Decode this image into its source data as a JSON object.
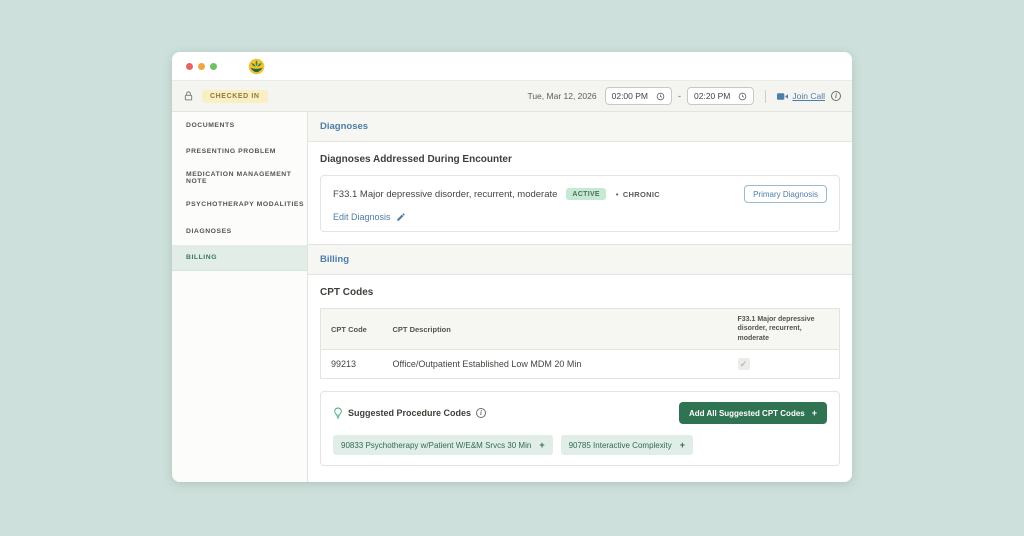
{
  "header": {
    "checked_in": "CHECKED IN",
    "date": "Tue, Mar 12, 2026",
    "start_time": "02:00 PM",
    "end_time": "02:20 PM",
    "time_separator": "-",
    "join_call": "Join Call"
  },
  "sidebar": {
    "active_item": "BILLING",
    "items": [
      {
        "label": "DOCUMENTS"
      },
      {
        "label": "PRESENTING PROBLEM"
      },
      {
        "label": "MEDICATION MANAGEMENT NOTE"
      },
      {
        "label": "PSYCHOTHERAPY MODALITIES"
      },
      {
        "label": "DIAGNOSES"
      },
      {
        "label": "BILLING"
      }
    ]
  },
  "diagnoses": {
    "section_title": "Diagnoses",
    "heading": "Diagnoses Addressed During Encounter",
    "name": "F33.1 Major depressive disorder, recurrent, moderate",
    "status_badge": "ACTIVE",
    "chronicity": "CHRONIC",
    "primary_button": "Primary Diagnosis",
    "edit_link": "Edit Diagnosis"
  },
  "billing": {
    "section_title": "Billing",
    "heading": "CPT Codes",
    "table": {
      "col_code": "CPT Code",
      "col_description": "CPT Description",
      "col_diagnosis": "F33.1 Major depressive disorder, recurrent, moderate",
      "rows": [
        {
          "code": "99213",
          "description": "Office/Outpatient Established Low MDM 20 Min",
          "checked": true
        }
      ]
    },
    "suggested": {
      "title": "Suggested Procedure Codes",
      "add_all_button": "Add All Suggested CPT Codes",
      "chips": [
        {
          "label": "90833 Psychotherapy w/Patient W/E&M Srvcs 30 Min"
        },
        {
          "label": "90785 Interactive Complexity"
        }
      ]
    }
  },
  "icons": {
    "check": "✓",
    "plus": "+",
    "bullet": "•",
    "info": "i"
  },
  "colors": {
    "page_bg": "#cee0db",
    "accent_blue": "#4d7ea8",
    "accent_green": "#2f7352",
    "active_badge_bg": "#c6e9d3",
    "checked_in_bg": "#f9efc3",
    "sidebar_active_bg": "#e2ede7",
    "traffic_red": "#e5655e",
    "traffic_yellow": "#f0a73f",
    "traffic_green": "#6fbf63"
  }
}
